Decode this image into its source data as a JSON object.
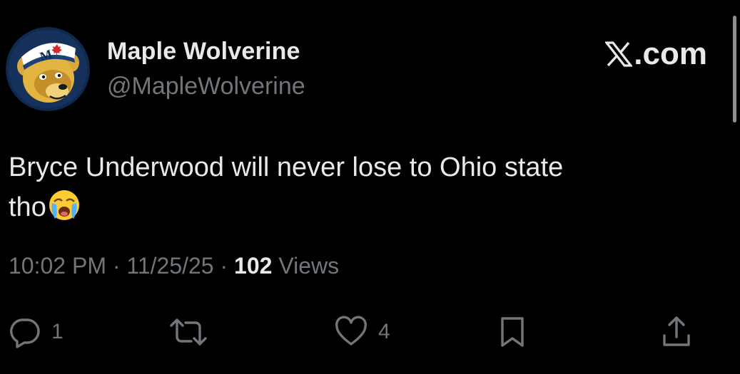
{
  "header": {
    "display_name": "Maple Wolverine",
    "handle": "@MapleWolverine",
    "brand": "X.com",
    "brand_suffix": ".com"
  },
  "tweet": {
    "line1": "Bryce Underwood will never lose to Ohio state",
    "line2": "tho",
    "emoji": "loudly-crying-face-emoji"
  },
  "meta": {
    "time": "10:02 PM",
    "separator": " · ",
    "date": "11/25/25",
    "views_count": "102",
    "views_label": " Views"
  },
  "actions": {
    "reply_count": "1",
    "retweet_count": "",
    "like_count": "4"
  },
  "colors": {
    "background": "#000000",
    "primary_text": "#e7e9ea",
    "secondary_text": "#71767b"
  },
  "icons": [
    "x-logo-icon",
    "reply-icon",
    "retweet-icon",
    "like-icon",
    "bookmark-icon",
    "share-icon"
  ]
}
